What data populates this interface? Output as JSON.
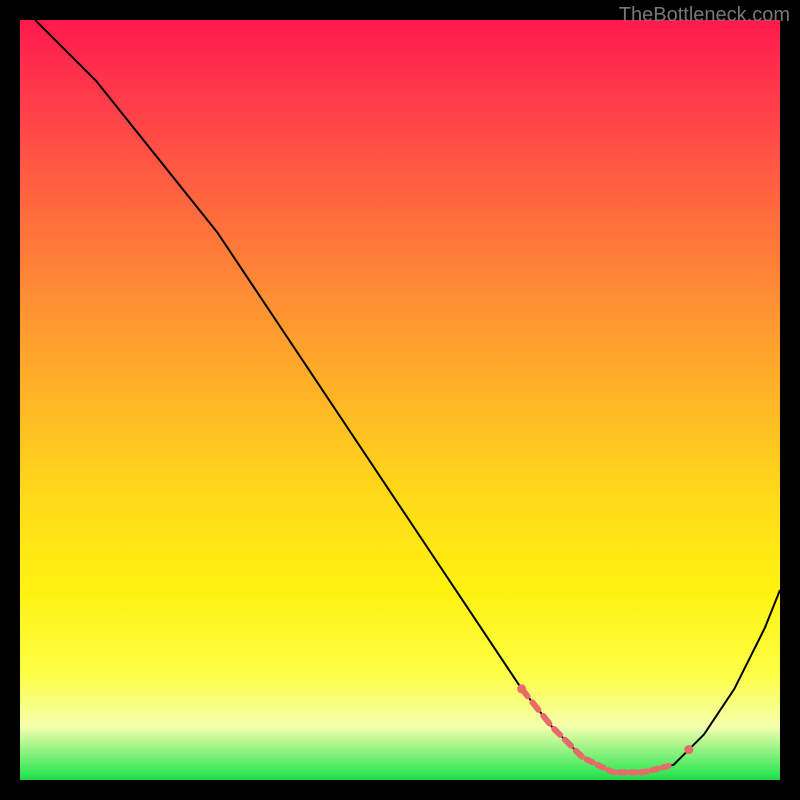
{
  "watermark": "TheBottleneck.com",
  "chart_data": {
    "type": "line",
    "title": "",
    "xlabel": "",
    "ylabel": "",
    "xlim": [
      0,
      100
    ],
    "ylim": [
      0,
      100
    ],
    "series": [
      {
        "name": "curve",
        "x": [
          2,
          6,
          10,
          14,
          18,
          22,
          26,
          30,
          34,
          38,
          42,
          46,
          50,
          54,
          58,
          62,
          66,
          70,
          74,
          78,
          82,
          86,
          90,
          94,
          98,
          100
        ],
        "y": [
          100,
          96,
          92,
          87,
          82,
          77,
          72,
          66,
          60,
          54,
          48,
          42,
          36,
          30,
          24,
          18,
          12,
          7,
          3,
          1,
          1,
          2,
          6,
          12,
          20,
          25
        ]
      }
    ],
    "highlight_range_x": [
      66,
      86
    ],
    "background_gradient": {
      "top": "#ff1a4d",
      "bottom": "#20d848"
    }
  }
}
